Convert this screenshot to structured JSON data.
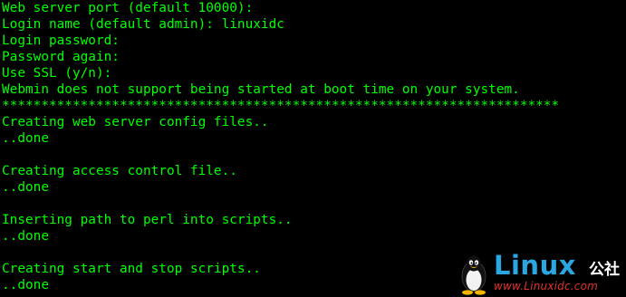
{
  "terminal": {
    "lines": [
      "Web server port (default 10000):",
      "Login name (default admin): linuxidc",
      "Login password:",
      "Password again:",
      "Use SSL (y/n):",
      "Webmin does not support being started at boot time on your system.",
      "***********************************************************************",
      "Creating web server config files..",
      "..done",
      "",
      "Creating access control file..",
      "..done",
      "",
      "Inserting path to perl into scripts..",
      "..done",
      "",
      "Creating start and stop scripts..",
      "..done"
    ],
    "colors": {
      "background": "#000000",
      "text": "#00ff00"
    }
  },
  "watermark": {
    "icon": "tux-penguin-icon",
    "brand": "Linux",
    "cjk": "公社",
    "url": "www.Linuxidc.com"
  }
}
